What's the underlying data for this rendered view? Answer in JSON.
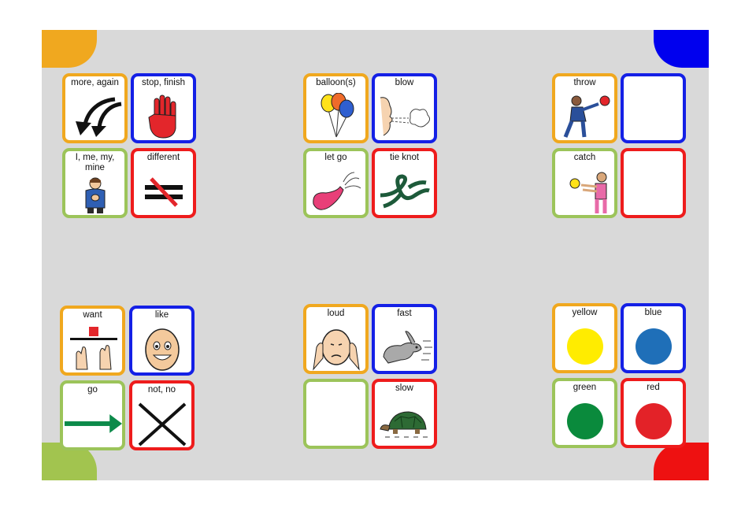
{
  "board": {
    "corners": {
      "top_left": "#f0a81f",
      "top_right": "#0000ee",
      "bottom_left": "#a2c44f",
      "bottom_right": "#ee1111"
    },
    "groups": [
      {
        "cards": [
          {
            "label": "more, again",
            "icon": "curved-arrows-icon",
            "border": "orange"
          },
          {
            "label": "stop, finish",
            "icon": "stop-hand-icon",
            "border": "blue"
          },
          {
            "label": "I, me, my, mine",
            "icon": "person-self-icon",
            "border": "green"
          },
          {
            "label": "different",
            "icon": "not-equal-icon",
            "border": "red"
          }
        ]
      },
      {
        "cards": [
          {
            "label": "balloon(s)",
            "icon": "balloons-icon",
            "border": "orange"
          },
          {
            "label": "blow",
            "icon": "blow-face-icon",
            "border": "blue"
          },
          {
            "label": "let go",
            "icon": "deflating-balloon-icon",
            "border": "green"
          },
          {
            "label": "tie knot",
            "icon": "knot-icon",
            "border": "red"
          }
        ]
      },
      {
        "cards": [
          {
            "label": "throw",
            "icon": "throw-ball-icon",
            "border": "orange"
          },
          {
            "label": "",
            "icon": "",
            "border": "blue"
          },
          {
            "label": "catch",
            "icon": "catch-ball-icon",
            "border": "green"
          },
          {
            "label": "",
            "icon": "",
            "border": "red"
          }
        ]
      },
      {
        "cards": [
          {
            "label": "want",
            "icon": "want-hands-icon",
            "border": "orange"
          },
          {
            "label": "like",
            "icon": "smiley-face-icon",
            "border": "blue"
          },
          {
            "label": "go",
            "icon": "green-arrow-icon",
            "border": "green"
          },
          {
            "label": "not, no",
            "icon": "cross-x-icon",
            "border": "red"
          }
        ]
      },
      {
        "cards": [
          {
            "label": "loud",
            "icon": "covering-ears-icon",
            "border": "orange"
          },
          {
            "label": "fast",
            "icon": "running-rabbit-icon",
            "border": "blue"
          },
          {
            "label": "",
            "icon": "",
            "border": "green"
          },
          {
            "label": "slow",
            "icon": "tortoise-icon",
            "border": "red"
          }
        ]
      },
      {
        "cards": [
          {
            "label": "yellow",
            "icon": "yellow-circle-icon",
            "border": "orange",
            "swatch": "#ffec00"
          },
          {
            "label": "blue",
            "icon": "blue-circle-icon",
            "border": "blue",
            "swatch": "#1f6fb8"
          },
          {
            "label": "green",
            "icon": "green-circle-icon",
            "border": "green",
            "swatch": "#0a8a3c"
          },
          {
            "label": "red",
            "icon": "red-circle-icon",
            "border": "red",
            "swatch": "#e32228"
          }
        ]
      }
    ]
  }
}
